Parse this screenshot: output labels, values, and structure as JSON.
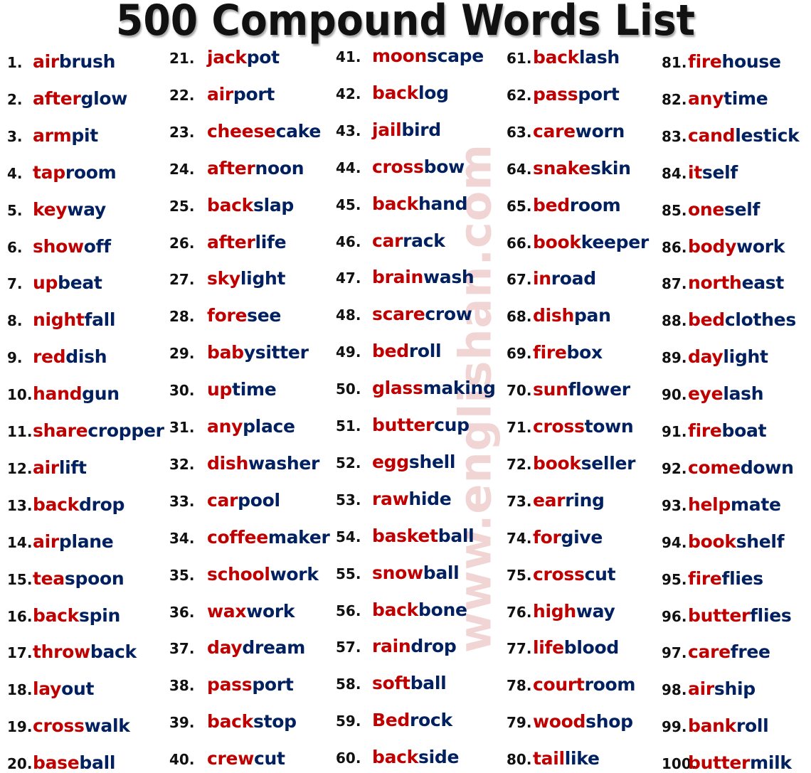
{
  "title": "500 Compound Words List",
  "watermark": "www.englishan.com",
  "colors": {
    "first_part": "#c00000",
    "second_part": "#002060",
    "number": "#111111",
    "watermark": "#f1d4d4"
  },
  "columns": [
    {
      "items": [
        {
          "n": "1.",
          "a": "air",
          "b": "brush"
        },
        {
          "n": "2.",
          "a": "after",
          "b": "glow"
        },
        {
          "n": "3.",
          "a": "arm",
          "b": "pit"
        },
        {
          "n": "4.",
          "a": "tap",
          "b": "room"
        },
        {
          "n": "5.",
          "a": "key",
          "b": "way"
        },
        {
          "n": "6.",
          "a": "show",
          "b": "off"
        },
        {
          "n": "7.",
          "a": "up",
          "b": "beat"
        },
        {
          "n": "8.",
          "a": "night",
          "b": "fall"
        },
        {
          "n": "9.",
          "a": "red",
          "b": "dish"
        },
        {
          "n": "10.",
          "a": "hand",
          "b": "gun"
        },
        {
          "n": "11.",
          "a": "share",
          "b": "cropper"
        },
        {
          "n": "12.",
          "a": "air",
          "b": "lift"
        },
        {
          "n": "13.",
          "a": "back",
          "b": "drop"
        },
        {
          "n": "14.",
          "a": "air",
          "b": "plane"
        },
        {
          "n": "15.",
          "a": "tea",
          "b": "spoon"
        },
        {
          "n": "16.",
          "a": "back",
          "b": "spin"
        },
        {
          "n": "17.",
          "a": "throw",
          "b": "back"
        },
        {
          "n": "18.",
          "a": "lay",
          "b": "out"
        },
        {
          "n": "19.",
          "a": "cross",
          "b": "walk"
        },
        {
          "n": "20.",
          "a": "base",
          "b": "ball"
        }
      ]
    },
    {
      "items": [
        {
          "n": "21.",
          "a": "jack",
          "b": "pot"
        },
        {
          "n": "22.",
          "a": "air",
          "b": "port"
        },
        {
          "n": "23.",
          "a": "cheese",
          "b": "cake"
        },
        {
          "n": "24.",
          "a": "after",
          "b": "noon"
        },
        {
          "n": "25.",
          "a": "back",
          "b": "slap"
        },
        {
          "n": "26.",
          "a": "after",
          "b": "life"
        },
        {
          "n": "27.",
          "a": "sky",
          "b": "light"
        },
        {
          "n": "28.",
          "a": "fore",
          "b": "see"
        },
        {
          "n": "29.",
          "a": "bab",
          "b": "ysitter"
        },
        {
          "n": "30.",
          "a": "up",
          "b": "time"
        },
        {
          "n": "31.",
          "a": "any",
          "b": "place"
        },
        {
          "n": "32.",
          "a": "dish",
          "b": "washer"
        },
        {
          "n": "33.",
          "a": "car",
          "b": "pool"
        },
        {
          "n": "34.",
          "a": "coffee",
          "b": "maker"
        },
        {
          "n": "35.",
          "a": "school",
          "b": "work"
        },
        {
          "n": "36.",
          "a": "wax",
          "b": "work"
        },
        {
          "n": "37.",
          "a": "day",
          "b": "dream"
        },
        {
          "n": "38.",
          "a": "pass",
          "b": "port"
        },
        {
          "n": "39.",
          "a": "back",
          "b": "stop"
        },
        {
          "n": "40.",
          "a": "crew",
          "b": "cut"
        }
      ]
    },
    {
      "items": [
        {
          "n": "41.",
          "a": "moon",
          "b": "scape"
        },
        {
          "n": "42.",
          "a": "back",
          "b": "log"
        },
        {
          "n": "43.",
          "a": "jail",
          "b": "bird"
        },
        {
          "n": "44.",
          "a": "cross",
          "b": "bow"
        },
        {
          "n": "45.",
          "a": "back",
          "b": "hand"
        },
        {
          "n": "46.",
          "a": "car",
          "b": "rack"
        },
        {
          "n": "47.",
          "a": "brain",
          "b": "wash"
        },
        {
          "n": "48.",
          "a": "scare",
          "b": "crow"
        },
        {
          "n": "49.",
          "a": "bed",
          "b": "roll"
        },
        {
          "n": "50.",
          "a": "glass",
          "b": "making"
        },
        {
          "n": "51.",
          "a": "butter",
          "b": "cup"
        },
        {
          "n": "52.",
          "a": "egg",
          "b": "shell"
        },
        {
          "n": "53.",
          "a": "raw",
          "b": "hide"
        },
        {
          "n": "54.",
          "a": "basket",
          "b": "ball"
        },
        {
          "n": "55.",
          "a": "snow",
          "b": "ball"
        },
        {
          "n": "56.",
          "a": "back",
          "b": "bone"
        },
        {
          "n": "57.",
          "a": "rain",
          "b": "drop"
        },
        {
          "n": "58.",
          "a": "soft",
          "b": "ball"
        },
        {
          "n": "59.",
          "a": "Bed",
          "b": "rock"
        },
        {
          "n": "60.",
          "a": "back",
          "b": "side"
        }
      ]
    },
    {
      "items": [
        {
          "n": "61.",
          "a": "back",
          "b": "lash"
        },
        {
          "n": "62.",
          "a": "pass",
          "b": "port"
        },
        {
          "n": "63.",
          "a": "care",
          "b": "worn"
        },
        {
          "n": "64.",
          "a": "snake",
          "b": "skin"
        },
        {
          "n": "65.",
          "a": "bed",
          "b": "room"
        },
        {
          "n": "66.",
          "a": "book",
          "b": "keeper"
        },
        {
          "n": "67.",
          "a": "in",
          "b": "road"
        },
        {
          "n": "68.",
          "a": "dish",
          "b": "pan"
        },
        {
          "n": "69.",
          "a": "fire",
          "b": "box"
        },
        {
          "n": "70.",
          "a": "sun",
          "b": "flower"
        },
        {
          "n": "71.",
          "a": "cross",
          "b": "town"
        },
        {
          "n": "72.",
          "a": "book",
          "b": "seller"
        },
        {
          "n": "73.",
          "a": "ear",
          "b": "ring"
        },
        {
          "n": "74.",
          "a": "for",
          "b": "give"
        },
        {
          "n": "75.",
          "a": "cross",
          "b": "cut"
        },
        {
          "n": "76.",
          "a": "high",
          "b": "way"
        },
        {
          "n": "77.",
          "a": "life",
          "b": "blood"
        },
        {
          "n": "78.",
          "a": "court",
          "b": "room"
        },
        {
          "n": "79.",
          "a": "wood",
          "b": "shop"
        },
        {
          "n": "80.",
          "a": "tail",
          "b": "like"
        }
      ]
    },
    {
      "items": [
        {
          "n": "81.",
          "a": "fire",
          "b": "house"
        },
        {
          "n": "82.",
          "a": "any",
          "b": "time"
        },
        {
          "n": "83.",
          "a": "cand",
          "b": "lestick"
        },
        {
          "n": "84.",
          "a": "it",
          "b": "self"
        },
        {
          "n": "85.",
          "a": "one",
          "b": "self"
        },
        {
          "n": "86.",
          "a": "body",
          "b": "work"
        },
        {
          "n": "87.",
          "a": "north",
          "b": "east"
        },
        {
          "n": "88.",
          "a": "bed",
          "b": "clothes"
        },
        {
          "n": "89.",
          "a": "day",
          "b": "light"
        },
        {
          "n": "90.",
          "a": "eye",
          "b": "lash"
        },
        {
          "n": "91.",
          "a": "fire",
          "b": "boat"
        },
        {
          "n": "92.",
          "a": "come",
          "b": "down"
        },
        {
          "n": "93.",
          "a": "help",
          "b": "mate"
        },
        {
          "n": "94.",
          "a": "book",
          "b": "shelf"
        },
        {
          "n": "95.",
          "a": "fire",
          "b": "flies"
        },
        {
          "n": "96.",
          "a": "butter",
          "b": "flies"
        },
        {
          "n": "97.",
          "a": "care",
          "b": "free"
        },
        {
          "n": "98.",
          "a": "air",
          "b": "ship"
        },
        {
          "n": "99.",
          "a": "bank",
          "b": "roll"
        },
        {
          "n": "100.",
          "a": "butter",
          "b": "milk"
        }
      ]
    }
  ]
}
